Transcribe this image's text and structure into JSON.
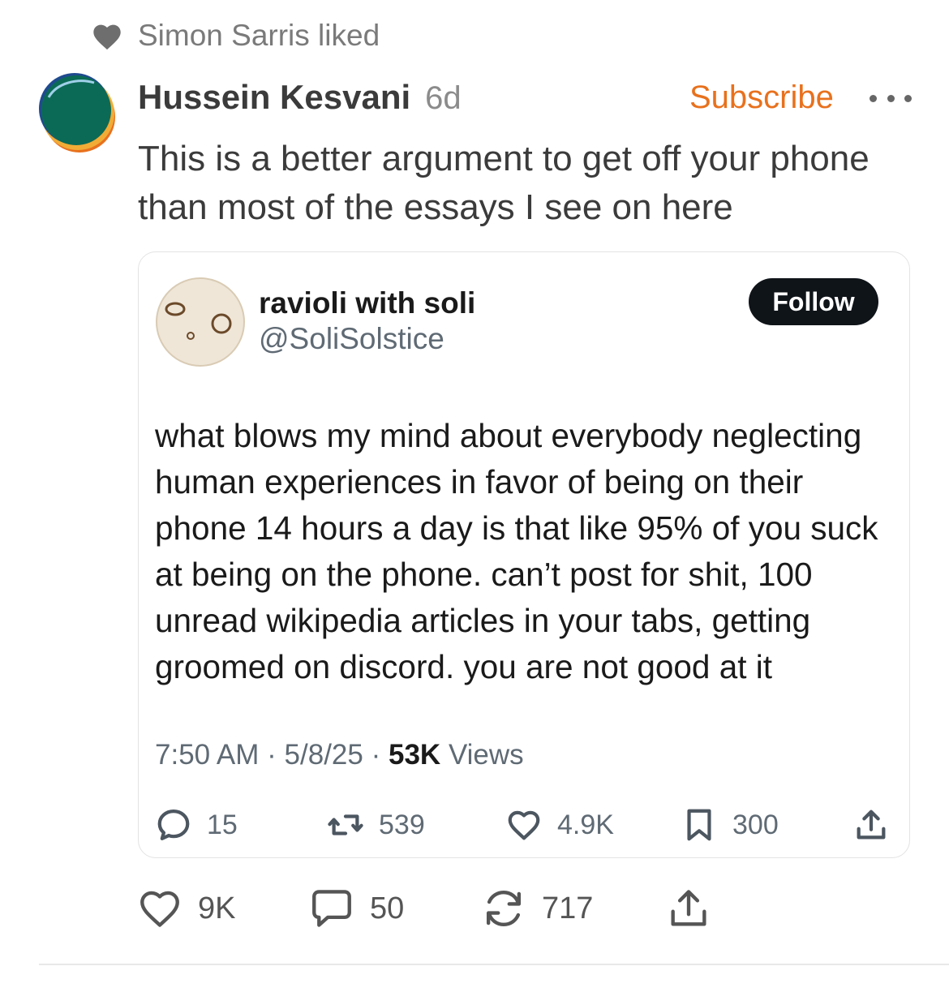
{
  "activity": {
    "icon": "heart-icon",
    "text": "Simon Sarris liked"
  },
  "note": {
    "author": "Hussein Kesvani",
    "time": "6d",
    "subscribe_label": "Subscribe",
    "text": "This is a better argument to get off your phone than most of the essays I see on here",
    "actions": {
      "likes": "9K",
      "comments": "50",
      "restacks": "717"
    }
  },
  "embed": {
    "display_name": "ravioli with soli",
    "handle": "@SoliSolstice",
    "follow_label": "Follow",
    "text": "what blows my mind about everybody neglecting human experiences in favor of being on their phone 14 hours a day is that like 95% of you suck at being on the phone. can’t post for shit, 100 unread wikipedia articles in your tabs, getting groomed on discord. you are not good at it",
    "time": "7:50 AM",
    "date": "5/8/25",
    "views_count": "53K",
    "views_label": "Views",
    "separator": "·",
    "actions": {
      "replies": "15",
      "retweets": "539",
      "likes": "4.9K",
      "bookmarks": "300"
    }
  },
  "colors": {
    "accent": "#e8711d",
    "follow_bg": "#0f1419",
    "muted": "#5f6a74"
  }
}
